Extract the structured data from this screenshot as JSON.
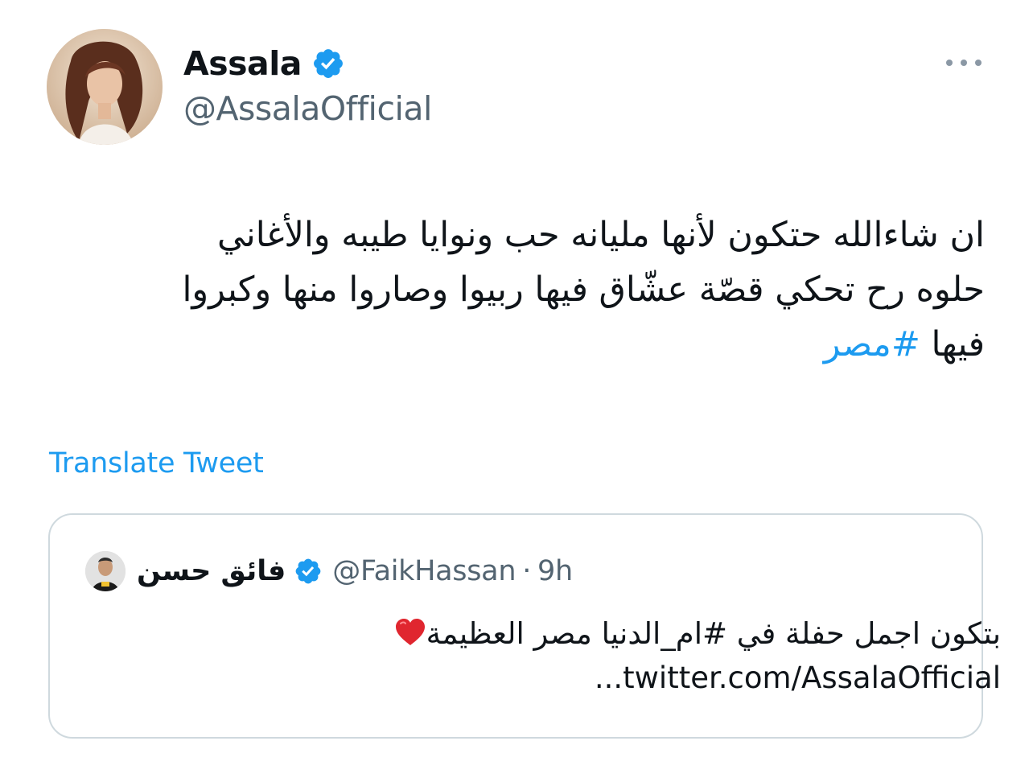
{
  "tweet": {
    "author": {
      "display_name": "Assala",
      "handle": "@AssalaOfficial",
      "verified": true
    },
    "more_icon": "more-horizontal-icon",
    "text_lines": [
      "ان شاءالله حتكون لأنها مليانه حب ونوايا طيبه والأغاني",
      "حلوه رح تحكي قصّة عشّاق فيها ربيوا وصاروا منها وكبروا"
    ],
    "text_line3_plain": "فيها ",
    "hashtag": "#مصر",
    "translate_label": "Translate Tweet"
  },
  "quoted_tweet": {
    "display_name": "فائق حسن",
    "handle": "@FaikHassan",
    "separator": "·",
    "time": "9h",
    "verified": true,
    "text_line1": "بتكون اجمل حفلة في #ام_الدنيا مصر العظيمة",
    "text_line1_emoji": "heart-emoji",
    "text_line2": "...twitter.com/AssalaOfficial"
  },
  "colors": {
    "accent": "#1d9bf0",
    "text_primary": "#0f1419",
    "text_secondary": "#536471",
    "border": "#cfd9de",
    "heart": "#e0262f"
  }
}
